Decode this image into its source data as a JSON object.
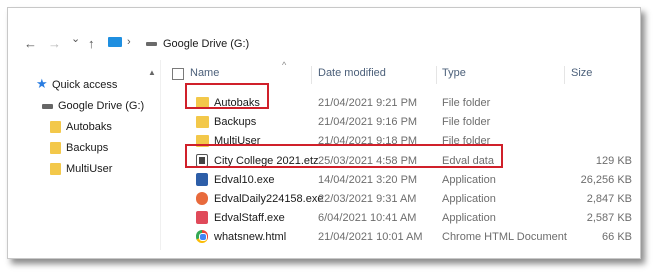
{
  "address": {
    "back_icon": "←",
    "forward_icon": "→",
    "dropdown_icon": "⌄",
    "up_icon": "↑",
    "separator": "›",
    "path": "Google Drive (G:)"
  },
  "nav_pane": {
    "items": [
      {
        "label": "Quick access",
        "icon": "star-icon"
      },
      {
        "label": "Google Drive (G:)",
        "icon": "drive-icon"
      },
      {
        "label": "Autobaks",
        "icon": "folder-icon"
      },
      {
        "label": "Backups",
        "icon": "folder-icon"
      },
      {
        "label": "MultiUser",
        "icon": "folder-icon"
      }
    ],
    "scroll_up_icon": "▲"
  },
  "columns": {
    "name": "Name",
    "date": "Date modified",
    "type": "Type",
    "size": "Size",
    "sort_caret": "^"
  },
  "files": [
    {
      "name": "Autobaks",
      "date": "21/04/2021 9:21 PM",
      "type": "File folder",
      "size": "",
      "icon": "folder-icon"
    },
    {
      "name": "Backups",
      "date": "21/04/2021 9:16 PM",
      "type": "File folder",
      "size": "",
      "icon": "folder-icon"
    },
    {
      "name": "MultiUser",
      "date": "21/04/2021 9:18 PM",
      "type": "File folder",
      "size": "",
      "icon": "folder-icon"
    },
    {
      "name": "City College 2021.etz",
      "date": "25/03/2021 4:58 PM",
      "type": "Edval data",
      "size": "129 KB",
      "icon": "edval-data-icon"
    },
    {
      "name": "Edval10.exe",
      "date": "14/04/2021 3:20 PM",
      "type": "Application",
      "size": "26,256 KB",
      "icon": "edval10-app-icon"
    },
    {
      "name": "EdvalDaily224158.exe",
      "date": "22/03/2021 9:31 AM",
      "type": "Application",
      "size": "2,847 KB",
      "icon": "edval-daily-app-icon"
    },
    {
      "name": "EdvalStaff.exe",
      "date": "6/04/2021 10:41 AM",
      "type": "Application",
      "size": "2,587 KB",
      "icon": "edval-staff-app-icon"
    },
    {
      "name": "whatsnew.html",
      "date": "21/04/2021 10:01 AM",
      "type": "Chrome HTML Document",
      "size": "66 KB",
      "icon": "chrome-html-icon"
    }
  ],
  "colors": {
    "highlight": "#d0202a",
    "folder": "#f3c84a",
    "accent": "#2a7de1"
  }
}
